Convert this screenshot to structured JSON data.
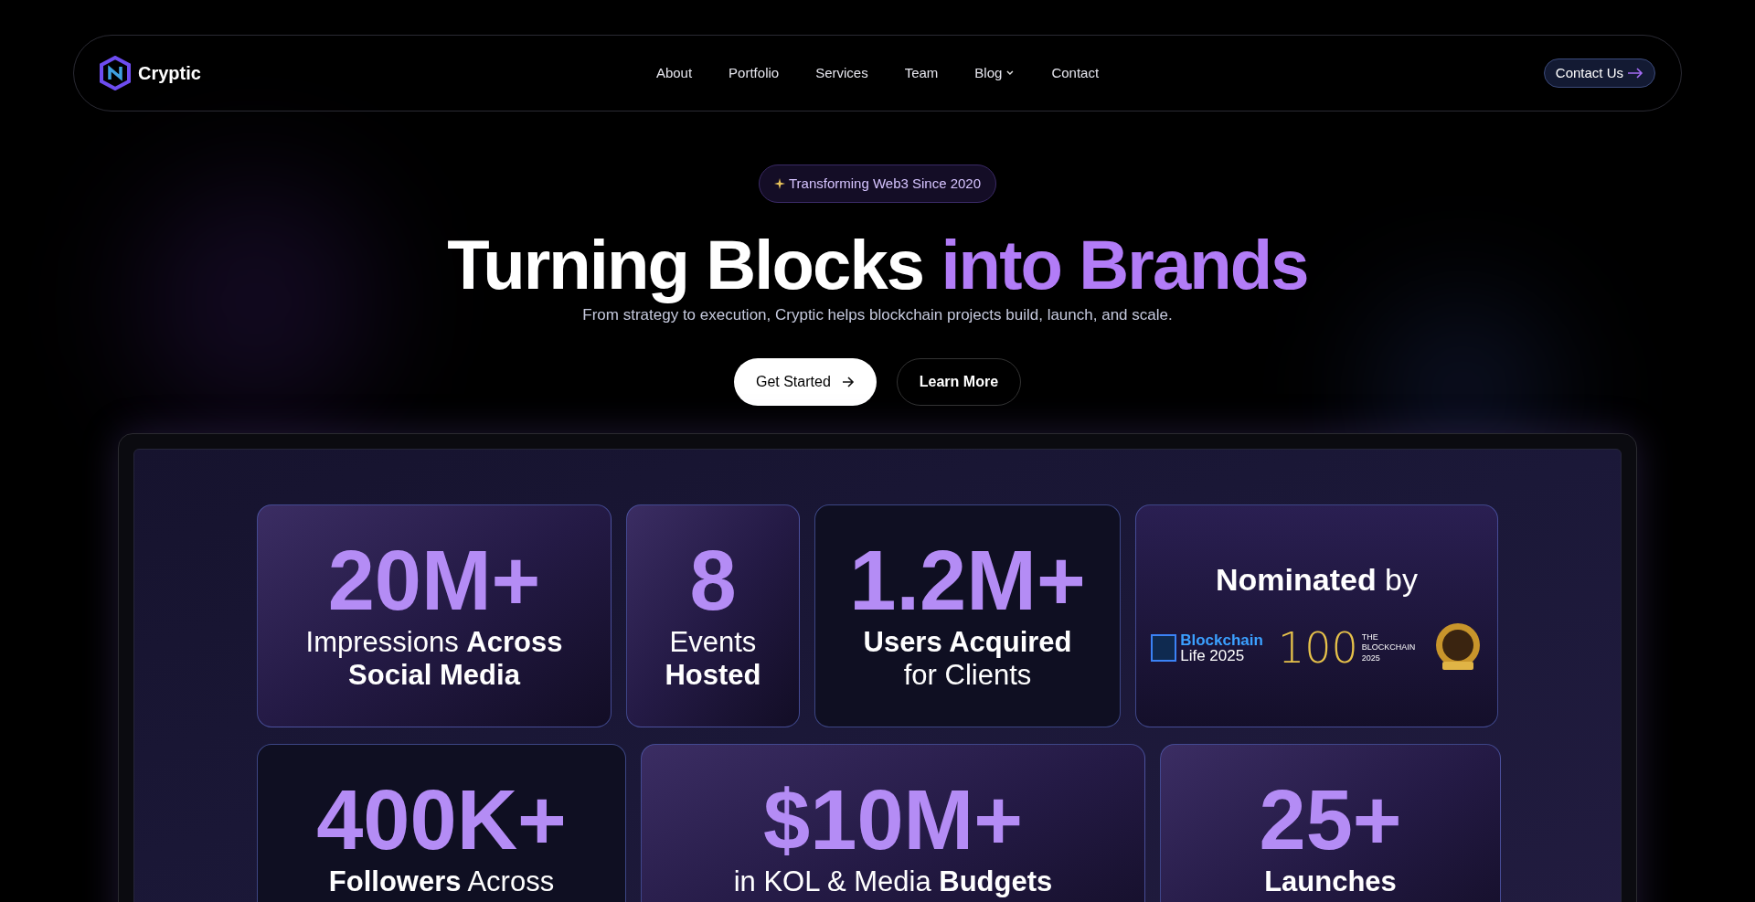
{
  "nav": {
    "brand": "Cryptic",
    "links": [
      {
        "label": "About",
        "kind": "link"
      },
      {
        "label": "Portfolio",
        "kind": "link"
      },
      {
        "label": "Services",
        "kind": "link"
      },
      {
        "label": "Team",
        "kind": "link"
      },
      {
        "label": "Blog",
        "kind": "dropdown"
      },
      {
        "label": "Contact",
        "kind": "link"
      }
    ],
    "cta": "Contact Us"
  },
  "hero": {
    "badge": "Transforming Web3 Since 2020",
    "title_white": "Turning Blocks",
    "title_purple": "into Brands",
    "subtitle": "From strategy to execution, Cryptic helps blockchain projects build, launch, and scale.",
    "primary_button": "Get Started",
    "secondary_button": "Learn More"
  },
  "stats_rows": [
    [
      {
        "kind": "stat",
        "value": "20M+",
        "caption": "Impressions **Across**\n**Social Media**",
        "photo": true
      },
      {
        "kind": "stat",
        "value": "8",
        "caption": "Events\n**Hosted**",
        "photo": true
      },
      {
        "kind": "stat",
        "value": "1.2M+",
        "caption": "**Users Acquired**\nfor Clients",
        "photo": false
      },
      {
        "kind": "awards",
        "title": "**Nominated** by",
        "logo_1_top": "Blockchain",
        "logo_1_bottom": "Life 2025",
        "logo_2_number": "100",
        "logo_2_text": "THE BLOCKCHAIN 2025"
      }
    ],
    [
      {
        "kind": "stat",
        "value": "400K+",
        "caption": "**Followers** Across",
        "photo": false
      },
      {
        "kind": "stat",
        "value": "$10M+",
        "caption": "in KOL & Media **Budgets**",
        "photo": true
      },
      {
        "kind": "stat",
        "value": "25+",
        "caption": "**Launches**",
        "photo": true
      }
    ]
  ]
}
